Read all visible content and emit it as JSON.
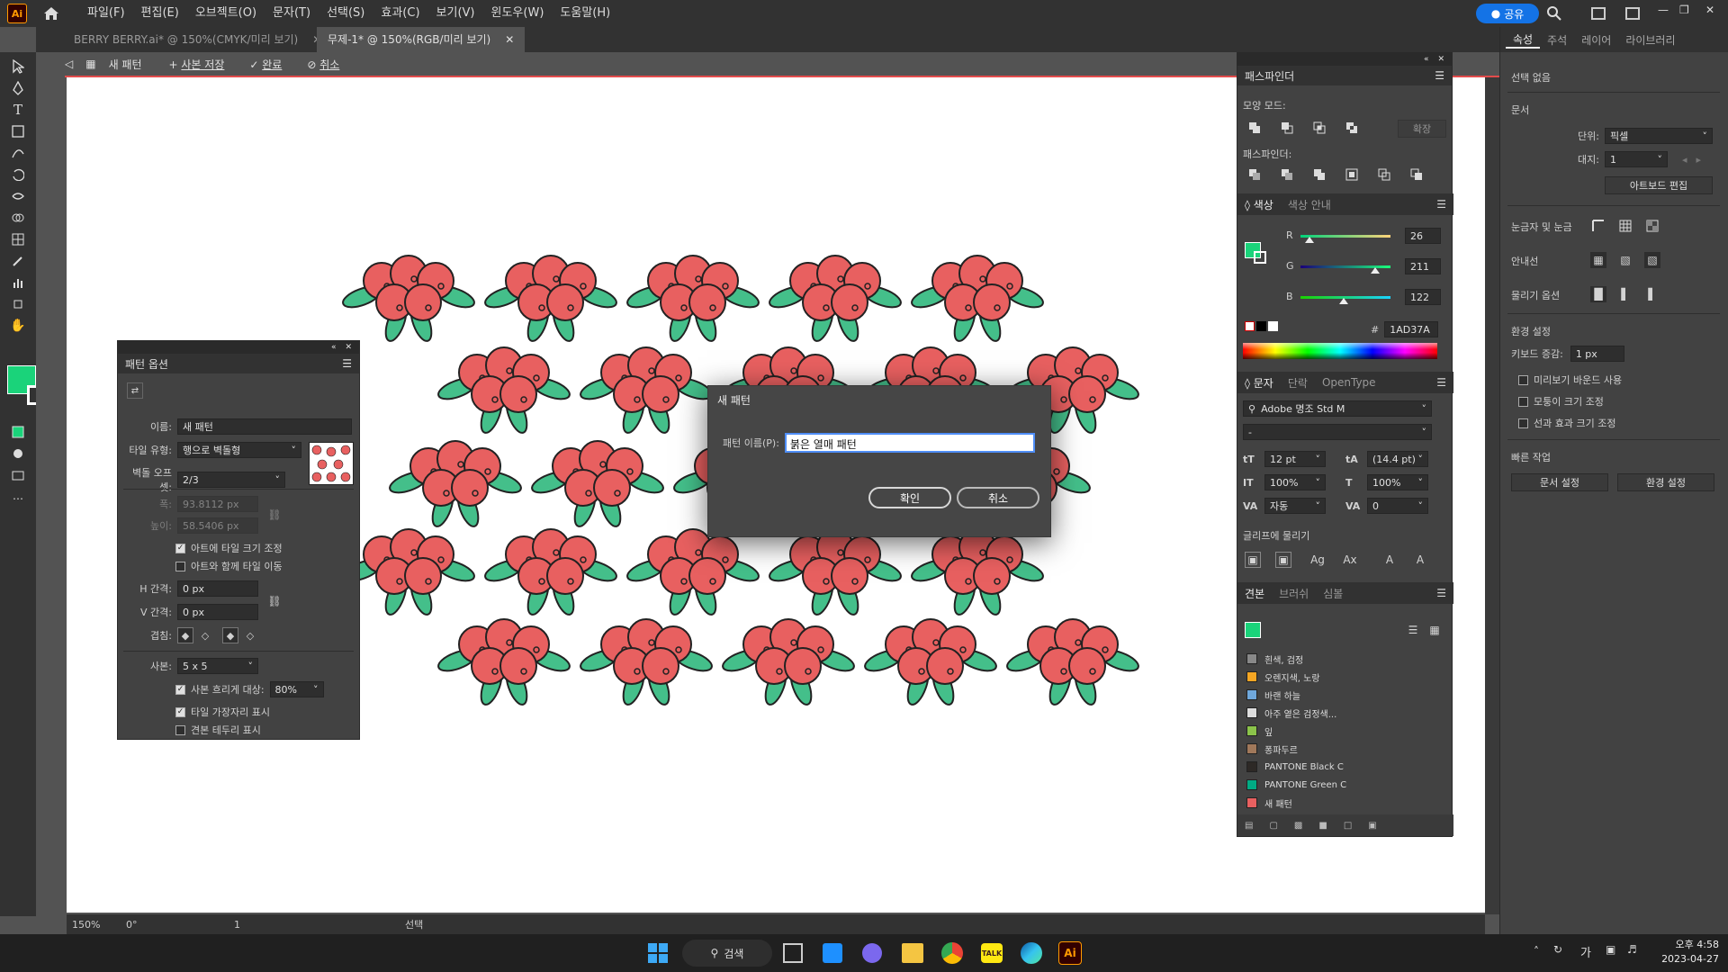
{
  "app": {
    "logo": "Ai",
    "menu": [
      "파일(F)",
      "편집(E)",
      "오브젝트(O)",
      "문자(T)",
      "선택(S)",
      "효과(C)",
      "보기(V)",
      "윈도우(W)",
      "도움말(H)"
    ],
    "share_label": "공유"
  },
  "tabs": [
    {
      "label": "BERRY BERRY.ai* @ 150%(CMYK/미리 보기)",
      "active": false
    },
    {
      "label": "무제-1* @ 150%(RGB/미리 보기)",
      "active": true
    }
  ],
  "pattern_bar": {
    "name": "새 패턴",
    "save_copy": "사본 저장",
    "done": "완료",
    "cancel": "취소"
  },
  "pattern_options": {
    "title": "패턴 옵션",
    "name_label": "이름:",
    "name_value": "새 패턴",
    "tile_type_label": "타일 유형:",
    "tile_type_value": "행으로 벽돌형",
    "brick_offset_label": "벽돌 오프셋:",
    "brick_offset_value": "2/3",
    "width_label": "폭:",
    "width_value": "93.8112 px",
    "height_label": "높이:",
    "height_value": "58.5406 px",
    "size_tile_to_art": "아트에 타일 크기 조정",
    "move_tile_with_art": "아트와 함께 타일 이동",
    "h_spacing_label": "H 간격:",
    "h_spacing_value": "0 px",
    "v_spacing_label": "V 간격:",
    "v_spacing_value": "0 px",
    "overlap_label": "겹침:",
    "copies_label": "사본:",
    "copies_value": "5 x 5",
    "dim_copies_label": "사본 흐리게 대상:",
    "dim_copies_value": "80%",
    "show_tile_edge": "타일 가장자리 표시",
    "show_swatch_bounds": "견본 테두리 표시"
  },
  "dialog": {
    "title": "새 패턴",
    "name_label": "패턴 이름(P):",
    "name_value": "붉은 열매 패턴",
    "ok": "확인",
    "cancel": "취소"
  },
  "pathfinder": {
    "title": "패스파인더",
    "shape_modes": "모양 모드:",
    "expand": "확장",
    "pathfinders": "패스파인더:"
  },
  "color": {
    "tab_color": "색상",
    "tab_guide": "색상 안내",
    "r_label": "R",
    "r": 26,
    "g_label": "G",
    "g": 211,
    "b_label": "B",
    "b": 122,
    "hash": "#",
    "hex": "1AD37A",
    "fill_color": "#1ad37a"
  },
  "character": {
    "tab_char": "문자",
    "tab_para": "단락",
    "tab_ot": "OpenType",
    "font": "Adobe 명조 Std M",
    "style": "-",
    "size": "12 pt",
    "leading": "(14.4 pt)",
    "vscale": "100%",
    "hscale": "100%",
    "kerning": "자동",
    "tracking": "0",
    "snap_label": "글리프에 물리기"
  },
  "swatches": {
    "tab_swatch": "견본",
    "tab_brush": "브러쉬",
    "tab_symbol": "심볼",
    "items": [
      {
        "name": "흰색, 검정",
        "color": "#888888"
      },
      {
        "name": "오렌지색, 노랑",
        "color": "#f5a623"
      },
      {
        "name": "바랜 하늘",
        "color": "#6fa8dc"
      },
      {
        "name": "아주 옅은 검정색...",
        "color": "#dddddd"
      },
      {
        "name": "잎",
        "color": "#8bc34a"
      },
      {
        "name": "퐁파두르",
        "color": "#a0785a"
      },
      {
        "name": "PANTONE Black C",
        "color": "#2d2926"
      },
      {
        "name": "PANTONE Green C",
        "color": "#00ab84"
      },
      {
        "name": "새 패턴",
        "color": "#e86060"
      }
    ]
  },
  "properties": {
    "tab_props": "속성",
    "tab_notes": "주석",
    "tab_layers": "레이어",
    "tab_libs": "라이브러리",
    "no_selection": "선택 없음",
    "document": "문서",
    "units_label": "단위:",
    "units_value": "픽셀",
    "artboard_label": "대지:",
    "artboard_value": "1",
    "edit_artboard": "아트보드 편집",
    "rulers_grids": "눈금자 및 눈금",
    "guides": "안내선",
    "snap_options": "물리기 옵션",
    "preferences": "환경 설정",
    "keyboard_inc_label": "키보드 증감:",
    "keyboard_inc_value": "1 px",
    "preview_bounds": "미리보기 바운드 사용",
    "scale_corners": "모퉁이 크기 조정",
    "scale_strokes": "선과 효과 크기 조정",
    "quick_actions": "빠른 작업",
    "doc_setup": "문서 설정",
    "pref_btn": "환경 설정"
  },
  "status": {
    "zoom": "150%",
    "rotate": "0°",
    "artboard": "1",
    "mode": "선택"
  },
  "taskbar": {
    "search": "검색",
    "lang": "가",
    "time": "오후 4:58",
    "date": "2023-04-27"
  },
  "colors": {
    "berry": "#e86060",
    "berry_dark": "#8a1f1f",
    "leaf": "#44bf8a",
    "outline": "#222222"
  }
}
